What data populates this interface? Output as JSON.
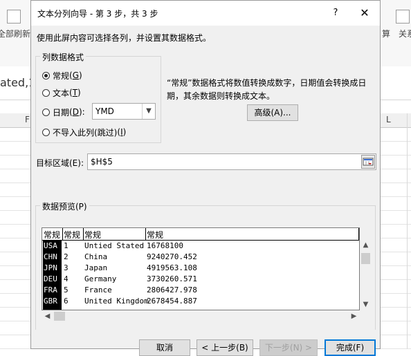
{
  "background": {
    "ribbon_left_label": "全部刷新",
    "ribbon_right_label_1": "算",
    "ribbon_right_label_2": "关系",
    "formula_fragment": "ated,1",
    "col_header_f": "F",
    "col_header_l": "L"
  },
  "dialog": {
    "title": "文本分列向导 - 第 3 步，共 3 步",
    "help_glyph": "?",
    "close_glyph": "✕",
    "description": "使用此屏内容可选择各列，并设置其数据格式。",
    "format_group": {
      "title": "列数据格式",
      "options": [
        {
          "label": "常规",
          "key": "G",
          "selected": true
        },
        {
          "label": "文本",
          "key": "T",
          "selected": false
        },
        {
          "label": "日期",
          "key": "D",
          "selected": false
        },
        {
          "label": "不导入此列(跳过)",
          "key": "I",
          "selected": false
        }
      ],
      "date_format": "YMD"
    },
    "note": "“常规”数据格式将数值转换成数字，日期值会转换成日期，其余数据则转换成文本。",
    "advanced_button": "高级(A)...",
    "target": {
      "label": "目标区域(E):",
      "value": "$H$5"
    },
    "preview": {
      "title": "数据预览(P)",
      "headers": [
        "常规",
        "常规",
        "常规",
        "常规"
      ],
      "rows": [
        [
          "USA",
          "1",
          "Untied Stated",
          "16768100"
        ],
        [
          "CHN",
          "2",
          "China",
          "9240270.452"
        ],
        [
          "JPN",
          "3",
          "Japan",
          "4919563.108"
        ],
        [
          "DEU",
          "4",
          "Germany",
          "3730260.571"
        ],
        [
          "FRA",
          "5",
          "France",
          "2806427.978"
        ],
        [
          "GBR",
          "6",
          "United Kingdom",
          "2678454.887"
        ]
      ]
    },
    "buttons": {
      "cancel": "取消",
      "back": "< 上一步(B)",
      "next": "下一步(N) >",
      "finish": "完成(F)"
    }
  }
}
